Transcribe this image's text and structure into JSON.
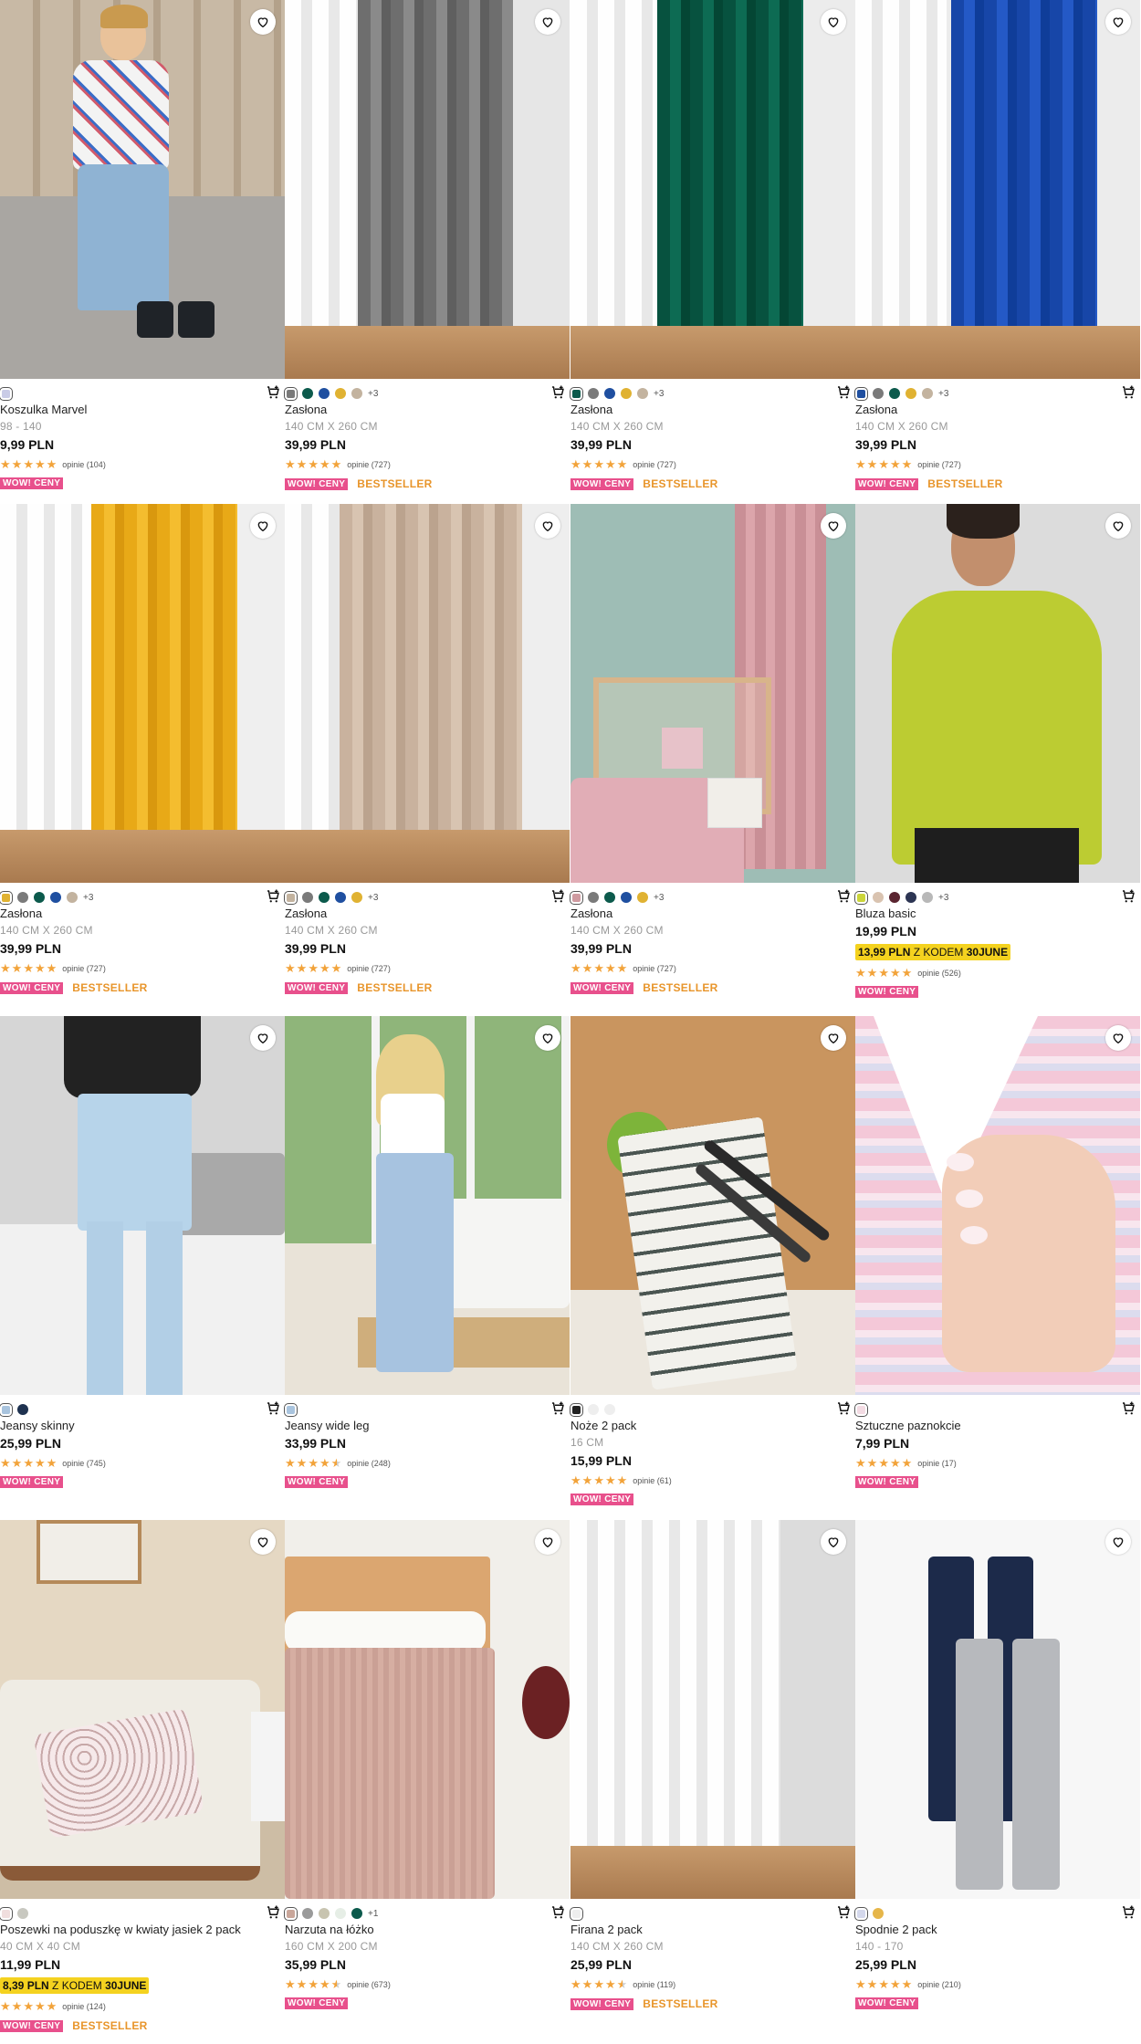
{
  "colors": {
    "wow": "#e8508c",
    "bestseller": "#e8952b",
    "promo": "#f4d21f",
    "star": "#f2a33a"
  },
  "products": [
    {
      "name": "Koszulka Marvel",
      "size": "98 - 140",
      "price": "9,99 PLN",
      "reviews": "opinie (104)",
      "rating": 5,
      "wow": "WOW! CENY",
      "image": "boy-tshirt-photo",
      "swatches": [
        "#c9cbe6"
      ],
      "more": ""
    },
    {
      "name": "Zasłona",
      "size": "140 CM X 260 CM",
      "price": "39,99 PLN",
      "reviews": "opinie (727)",
      "rating": 5,
      "wow": "WOW! CENY",
      "bestseller": "BESTSELLER",
      "image": "grey-curtain-photo",
      "swatches": [
        "#7a7a7a",
        "#0c5a4c",
        "#1f4fa0",
        "#e0b232",
        "#c3b39f"
      ],
      "more": "+3"
    },
    {
      "name": "Zasłona",
      "size": "140 CM X 260 CM",
      "price": "39,99 PLN",
      "reviews": "opinie (727)",
      "rating": 5,
      "wow": "WOW! CENY",
      "bestseller": "BESTSELLER",
      "image": "green-curtain-photo",
      "swatches": [
        "#0c5a4c",
        "#7a7a7a",
        "#1f4fa0",
        "#e0b232",
        "#c3b39f"
      ],
      "more": "+3"
    },
    {
      "name": "Zasłona",
      "size": "140 CM X 260 CM",
      "price": "39,99 PLN",
      "reviews": "opinie (727)",
      "rating": 5,
      "wow": "WOW! CENY",
      "bestseller": "BESTSELLER",
      "image": "blue-curtain-photo",
      "swatches": [
        "#1f4fa0",
        "#7a7a7a",
        "#0c5a4c",
        "#e0b232",
        "#c3b39f"
      ],
      "more": "+3"
    },
    {
      "name": "Zasłona",
      "size": "140 CM X 260 CM",
      "price": "39,99 PLN",
      "reviews": "opinie (727)",
      "rating": 5,
      "wow": "WOW! CENY",
      "bestseller": "BESTSELLER",
      "image": "yellow-curtain-photo",
      "swatches": [
        "#e0b232",
        "#7a7a7a",
        "#0c5a4c",
        "#1f4fa0",
        "#c3b39f"
      ],
      "more": "+3"
    },
    {
      "name": "Zasłona",
      "size": "140 CM X 260 CM",
      "price": "39,99 PLN",
      "reviews": "opinie (727)",
      "rating": 5,
      "wow": "WOW! CENY",
      "bestseller": "BESTSELLER",
      "image": "beige-curtain-photo",
      "swatches": [
        "#c3b39f",
        "#7a7a7a",
        "#0c5a4c",
        "#1f4fa0",
        "#e0b232"
      ],
      "more": "+3"
    },
    {
      "name": "Zasłona",
      "size": "140 CM X 260 CM",
      "price": "39,99 PLN",
      "reviews": "opinie (727)",
      "rating": 5,
      "wow": "WOW! CENY",
      "bestseller": "BESTSELLER",
      "image": "pink-curtain-kids-room-photo",
      "swatches": [
        "#cf9aa0",
        "#7a7a7a",
        "#0c5a4c",
        "#1f4fa0",
        "#e0b232"
      ],
      "more": "+3"
    },
    {
      "name": "Bluza basic",
      "price": "19,99 PLN",
      "promo_price": "13,99 PLN",
      "promo_text": "Z KODEM",
      "promo_code": "30JUNE",
      "reviews": "opinie (526)",
      "rating": 5,
      "wow": "WOW! CENY",
      "image": "lime-sweatshirt-photo",
      "swatches": [
        "#cbd53a",
        "#d9c3b0",
        "#5a2430",
        "#2c3553",
        "#b8b8b8"
      ],
      "more": "+3"
    },
    {
      "name": "Jeansy skinny",
      "price": "25,99 PLN",
      "reviews": "opinie (745)",
      "rating": 5,
      "wow": "WOW! CENY",
      "image": "skinny-jeans-photo",
      "swatches": [
        "#a9c4de",
        "#1e3250"
      ],
      "more": ""
    },
    {
      "name": "Jeansy wide leg",
      "price": "33,99 PLN",
      "reviews": "opinie (248)",
      "rating": 4.5,
      "wow": "WOW! CENY",
      "image": "wide-leg-jeans-photo",
      "swatches": [
        "#a9c4de"
      ],
      "more": ""
    },
    {
      "name": "Noże 2 pack",
      "size": "16 CM",
      "price": "15,99 PLN",
      "reviews": "opinie (61)",
      "rating": 5,
      "wow": "WOW! CENY",
      "image": "knives-photo",
      "swatches": [
        "#222222",
        "#eeeeee",
        "#eeeeee"
      ],
      "more": ""
    },
    {
      "name": "Sztuczne paznokcie",
      "price": "7,99 PLN",
      "reviews": "opinie (17)",
      "rating": 5,
      "wow": "WOW! CENY",
      "image": "artificial-nails-photo",
      "swatches": [
        "#f3dbe3"
      ],
      "more": ""
    },
    {
      "name": "Poszewki na poduszkę w kwiaty jasiek 2 pack",
      "size": "40 CM X 40 CM",
      "price": "11,99 PLN",
      "promo_price": "8,39 PLN",
      "promo_text": "Z KODEM",
      "promo_code": "30JUNE",
      "reviews": "opinie (124)",
      "rating": 5,
      "wow": "WOW! CENY",
      "bestseller": "BESTSELLER",
      "image": "floral-pillowcase-photo",
      "swatches": [
        "#f0dede",
        "#c8c8c0"
      ],
      "more": ""
    },
    {
      "name": "Narzuta na łóżko",
      "size": "160 CM X 200 CM",
      "price": "35,99 PLN",
      "reviews": "opinie (673)",
      "rating": 4.5,
      "wow": "WOW! CENY",
      "image": "bedspread-photo",
      "swatches": [
        "#c9a69a",
        "#9a9a9a",
        "#c8c4b0",
        "#e6eee6",
        "#0c5a4c"
      ],
      "more": "+1"
    },
    {
      "name": "Firana 2 pack",
      "size": "140 CM X 260 CM",
      "price": "25,99 PLN",
      "reviews": "opinie (119)",
      "rating": 4.5,
      "wow": "WOW! CENY",
      "bestseller": "BESTSELLER",
      "image": "sheer-curtain-photo",
      "swatches": [
        "#eeeeee"
      ],
      "more": ""
    },
    {
      "name": "Spodnie 2 pack",
      "size": "140 - 170",
      "price": "25,99 PLN",
      "reviews": "opinie (210)",
      "rating": 5,
      "wow": "WOW! CENY",
      "image": "kids-joggers-photo",
      "swatches": [
        "#d4d8ec",
        "#e6b64a"
      ],
      "more": ""
    }
  ]
}
